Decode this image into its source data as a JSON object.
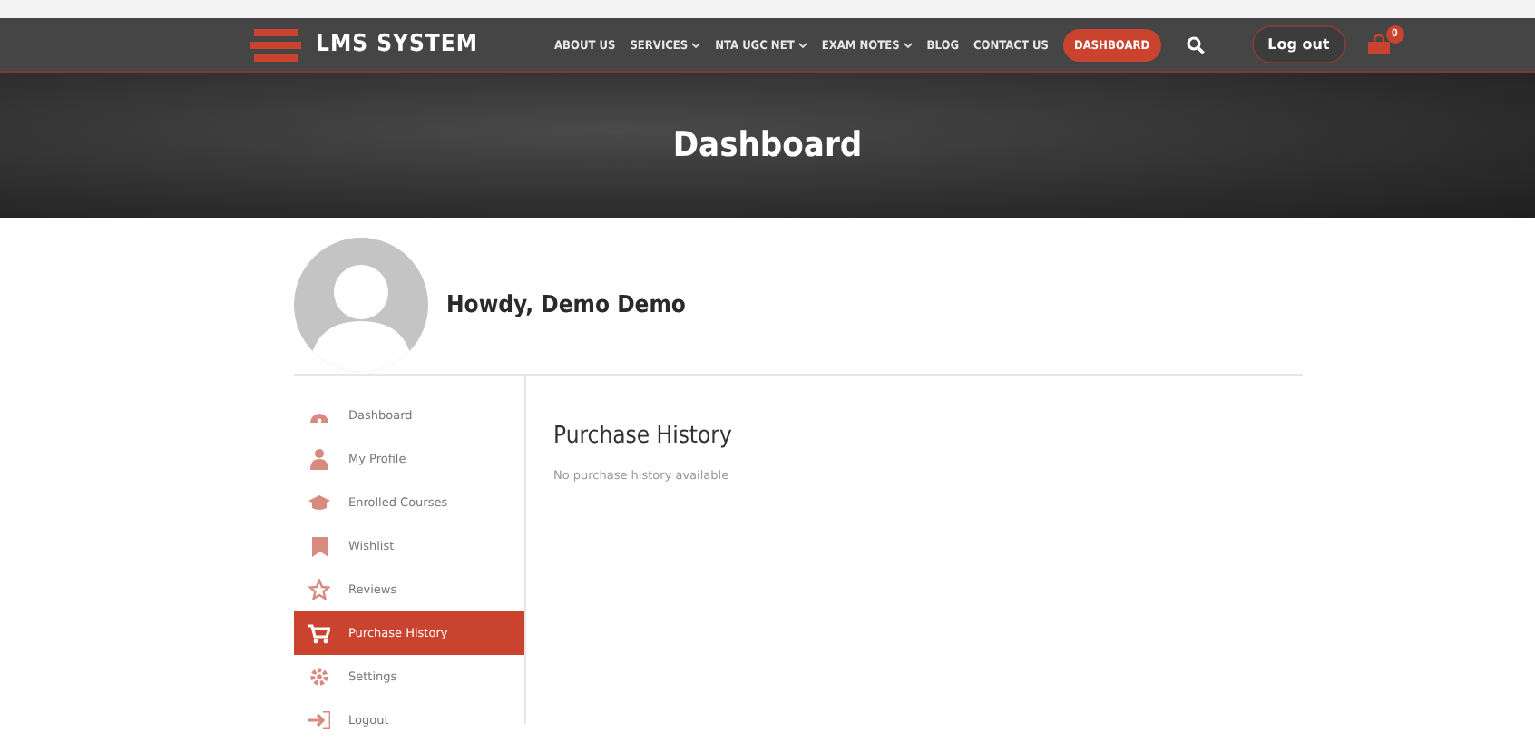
{
  "header": {
    "logo": "LMS SYSTEM",
    "nav": [
      {
        "label": "ABOUT US",
        "dropdown": false,
        "selected": false
      },
      {
        "label": "SERVICES",
        "dropdown": true,
        "selected": false
      },
      {
        "label": "NTA UGC NET",
        "dropdown": true,
        "selected": false
      },
      {
        "label": "EXAM NOTES",
        "dropdown": true,
        "selected": false
      },
      {
        "label": "BLOG",
        "dropdown": false,
        "selected": false
      },
      {
        "label": "CONTACT US",
        "dropdown": false,
        "selected": false
      },
      {
        "label": "DASHBOARD",
        "dropdown": false,
        "selected": true
      }
    ],
    "logout": "Log out",
    "cart_count": "0"
  },
  "hero": {
    "title": "Dashboard"
  },
  "profile": {
    "greeting": "Howdy, Demo Demo"
  },
  "sidebar": {
    "items": [
      {
        "label": "Dashboard",
        "selected": false
      },
      {
        "label": "My Profile",
        "selected": false
      },
      {
        "label": "Enrolled Courses",
        "selected": false
      },
      {
        "label": "Wishlist",
        "selected": false
      },
      {
        "label": "Reviews",
        "selected": false
      },
      {
        "label": "Purchase History",
        "selected": true
      },
      {
        "label": "Settings",
        "selected": false
      },
      {
        "label": "Logout",
        "selected": false
      }
    ]
  },
  "content": {
    "title": "Purchase History",
    "message": "No purchase history available"
  }
}
